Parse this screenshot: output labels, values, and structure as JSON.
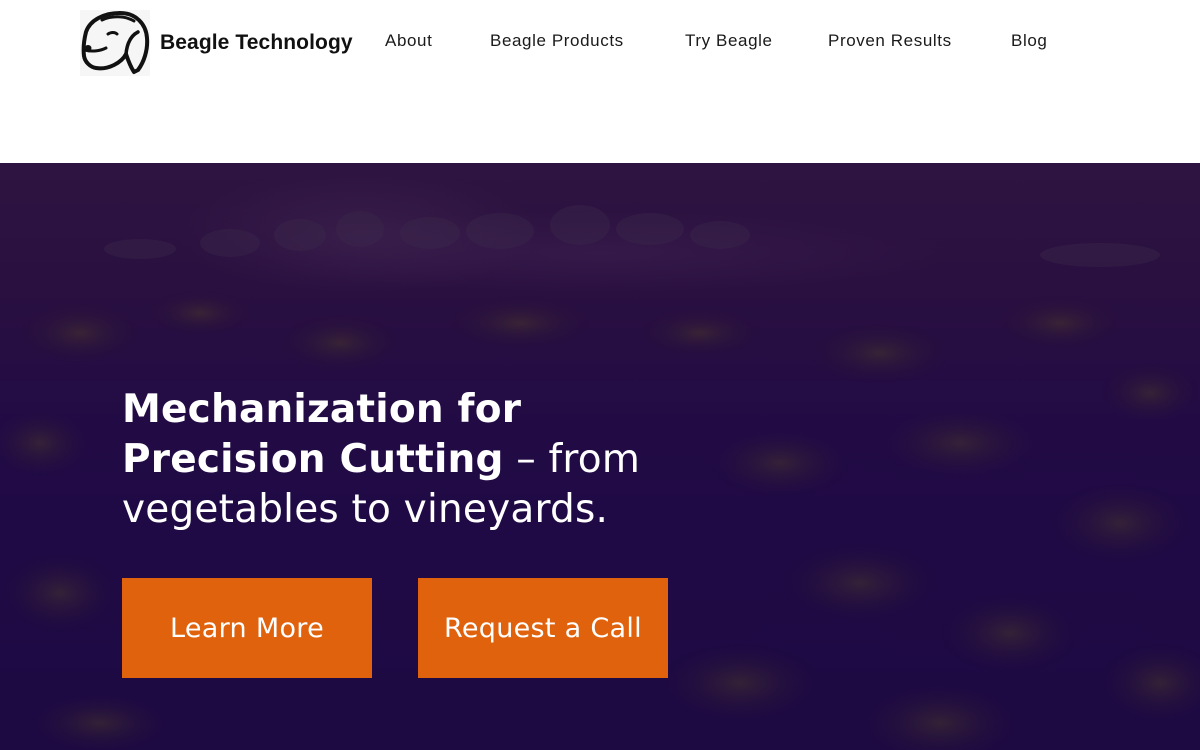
{
  "header": {
    "brand_name": "Beagle Technology",
    "logo_icon": "beagle-dog-head-icon",
    "nav": [
      {
        "label": "About"
      },
      {
        "label": "Beagle Products"
      },
      {
        "label": "Try Beagle"
      },
      {
        "label": "Proven Results"
      },
      {
        "label": "Blog"
      }
    ]
  },
  "hero": {
    "title_strong_line1": "Mechanization for",
    "title_strong_line2": "Precision Cutting",
    "title_light": " – from vegetables to vineyards.",
    "primary_button": "Learn More",
    "secondary_button": "Request a Call"
  },
  "colors": {
    "accent_orange": "#e0620d",
    "hero_overlay_purple": "#220b45",
    "nav_text": "#1a1a1a"
  }
}
